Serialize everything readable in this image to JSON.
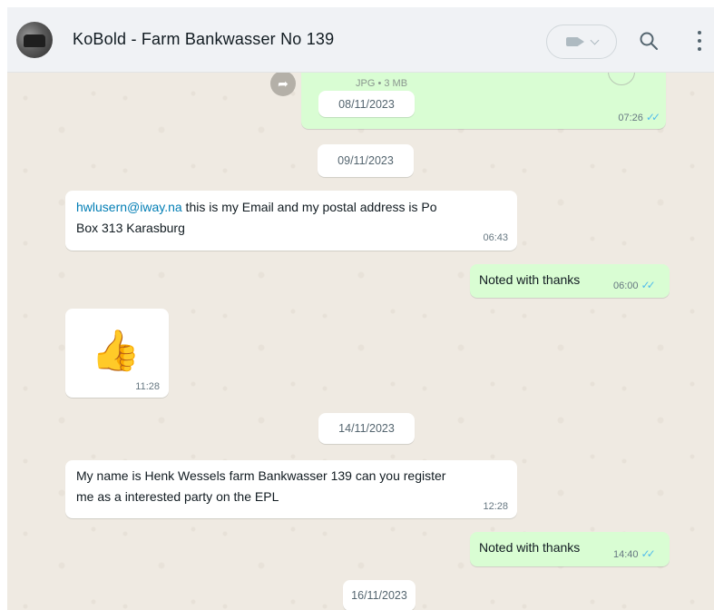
{
  "header": {
    "title": "KoBold - Farm Bankwasser No 139"
  },
  "messages": {
    "m1": {
      "attachment_meta": "JPG • 3 MB",
      "time": "07:26"
    },
    "m2": {
      "link": "hwlusern@iway.na",
      "text_a": " this is my Email and my postal address is Po",
      "text_b": "Box 313 Karasburg",
      "time": "06:43"
    },
    "m3": {
      "text": "Noted with thanks",
      "time": "06:00"
    },
    "m4": {
      "emoji": "👍",
      "time": "11:28"
    },
    "m5": {
      "line1": "My name is Henk Wessels farm Bankwasser 139 can you register",
      "line2": "me as a interested party on the EPL",
      "time": "12:28"
    },
    "m6": {
      "text": "Noted with thanks",
      "time": "14:40"
    }
  },
  "dates": {
    "d1": "08/11/2023",
    "d2": "09/11/2023",
    "d3": "14/11/2023",
    "d4": "16/11/2023"
  },
  "status": {
    "read_ticks": "✓✓"
  },
  "colors": {
    "outgoing": "#d9fdd3",
    "incoming": "#ffffff",
    "read": "#53bdeb"
  }
}
